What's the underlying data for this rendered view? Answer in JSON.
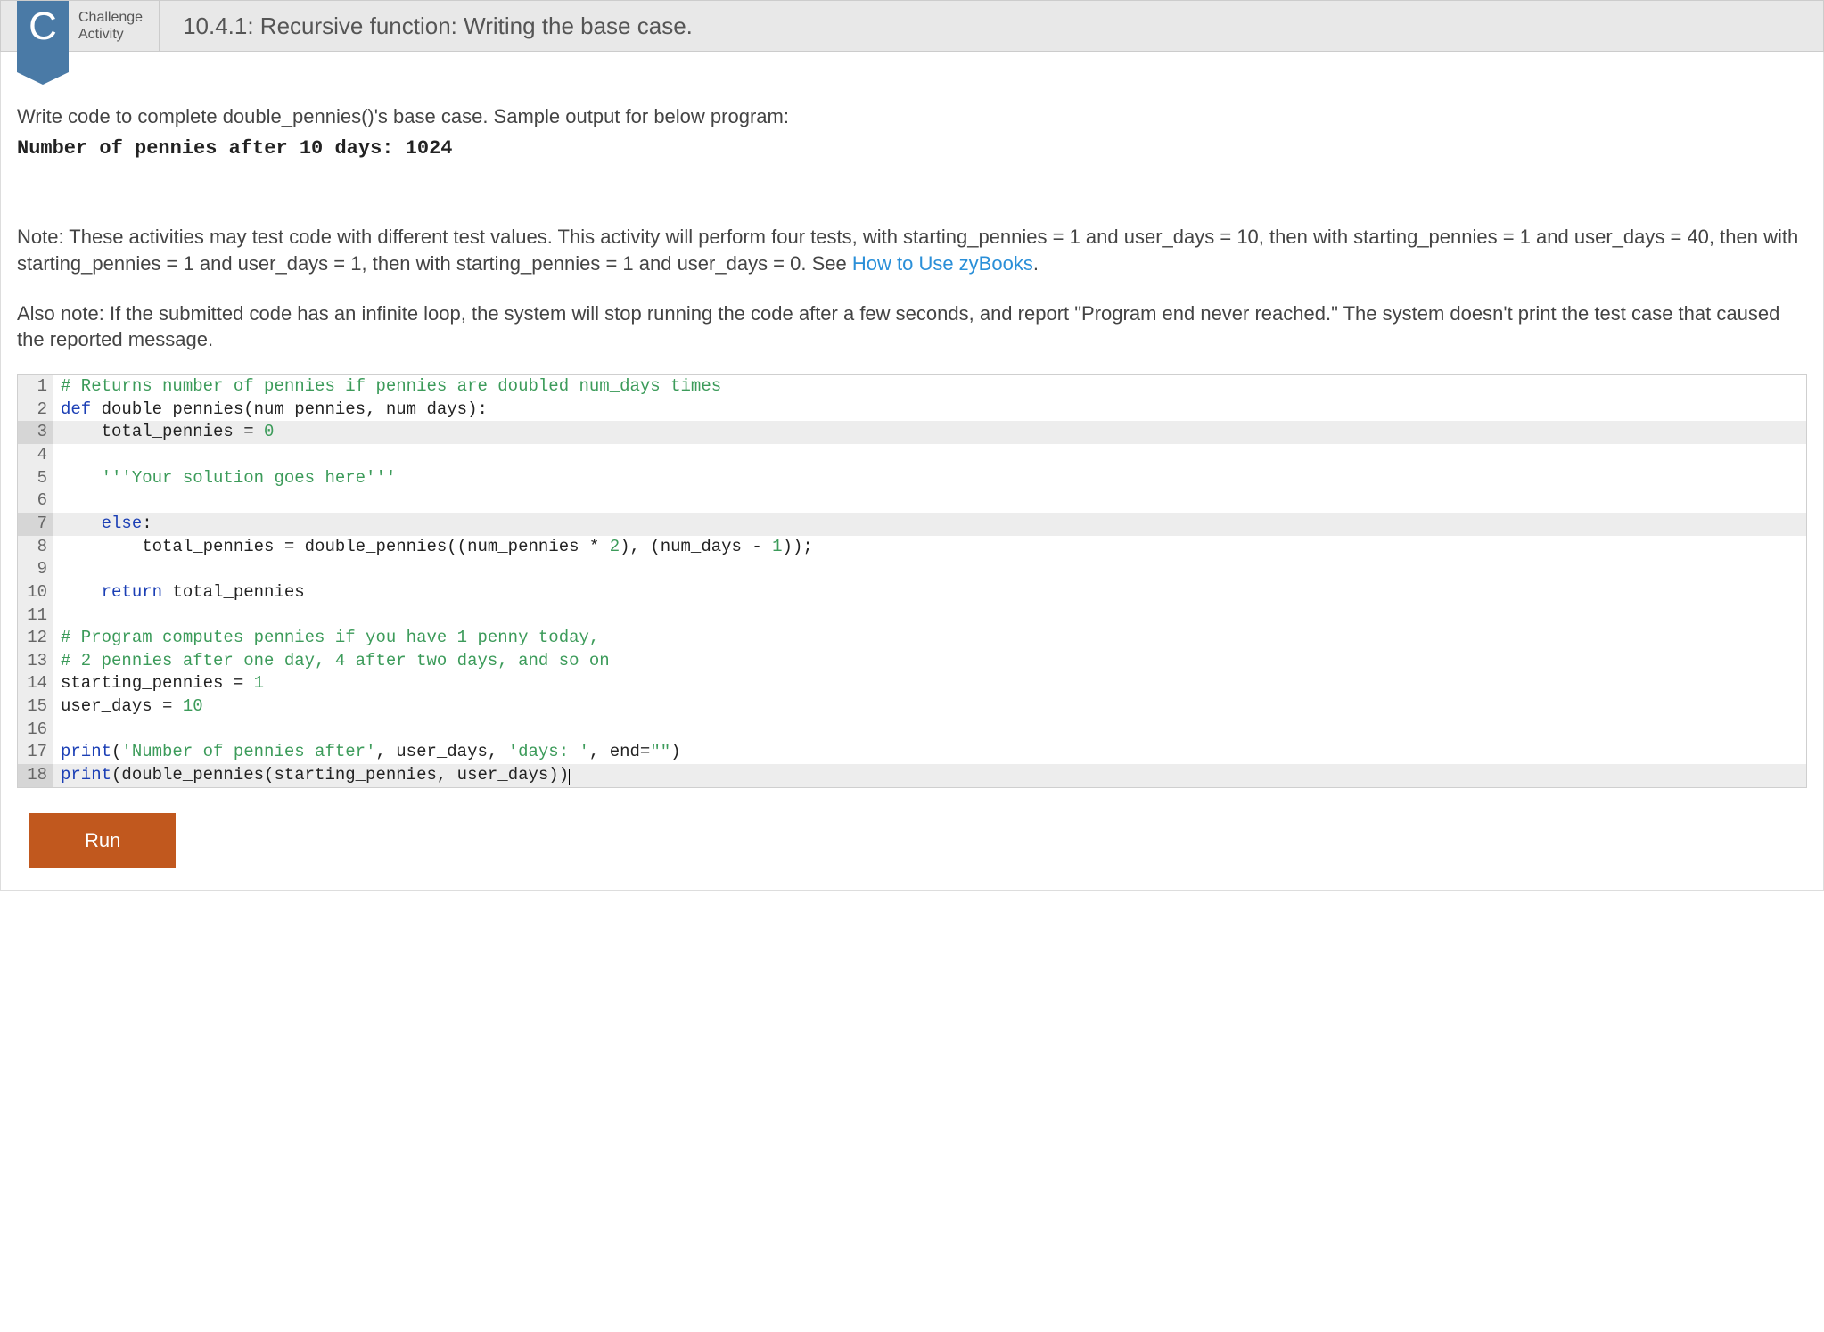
{
  "header": {
    "badge_letter": "C",
    "badge_line1": "Challenge",
    "badge_line2": "Activity",
    "title": "10.4.1: Recursive function: Writing the base case."
  },
  "instructions": {
    "prompt": "Write code to complete double_pennies()'s base case. Sample output for below program:",
    "sample_output": "Number of pennies after 10 days: 1024",
    "note_prefix": "Note: These activities may test code with different test values. This activity will perform four tests, with starting_pennies = 1 and user_days = 10, then with starting_pennies = 1 and user_days = 40, then with starting_pennies = 1 and user_days = 1, then with starting_pennies = 1 and user_days = 0. See ",
    "note_link_text": "How to Use zyBooks",
    "note_suffix": ".",
    "sub_note": "Also note: If the submitted code has an infinite loop, the system will stop running the code after a few seconds, and report \"Program end never reached.\" The system doesn't print the test case that caused the reported message."
  },
  "code": {
    "highlighted_lines": [
      3,
      7,
      18
    ],
    "lines": [
      {
        "n": 1,
        "tokens": [
          {
            "t": "# Returns number of pennies if pennies are doubled num_days times",
            "c": "comment"
          }
        ]
      },
      {
        "n": 2,
        "tokens": [
          {
            "t": "def",
            "c": "keyword"
          },
          {
            "t": " double_pennies(num_pennies, num_days):",
            "c": "plain"
          }
        ]
      },
      {
        "n": 3,
        "tokens": [
          {
            "t": "    total_pennies = ",
            "c": "plain"
          },
          {
            "t": "0",
            "c": "number"
          }
        ]
      },
      {
        "n": 4,
        "tokens": []
      },
      {
        "n": 5,
        "tokens": [
          {
            "t": "    ",
            "c": "plain"
          },
          {
            "t": "'''Your solution goes here'''",
            "c": "string"
          }
        ]
      },
      {
        "n": 6,
        "tokens": []
      },
      {
        "n": 7,
        "tokens": [
          {
            "t": "    ",
            "c": "plain"
          },
          {
            "t": "else",
            "c": "keyword"
          },
          {
            "t": ":",
            "c": "plain"
          }
        ]
      },
      {
        "n": 8,
        "tokens": [
          {
            "t": "        total_pennies = double_pennies((num_pennies * ",
            "c": "plain"
          },
          {
            "t": "2",
            "c": "number"
          },
          {
            "t": "), (num_days - ",
            "c": "plain"
          },
          {
            "t": "1",
            "c": "number"
          },
          {
            "t": "));",
            "c": "plain"
          }
        ]
      },
      {
        "n": 9,
        "tokens": []
      },
      {
        "n": 10,
        "tokens": [
          {
            "t": "    ",
            "c": "plain"
          },
          {
            "t": "return",
            "c": "keyword"
          },
          {
            "t": " total_pennies",
            "c": "plain"
          }
        ]
      },
      {
        "n": 11,
        "tokens": []
      },
      {
        "n": 12,
        "tokens": [
          {
            "t": "# Program computes pennies if you have 1 penny today,",
            "c": "comment"
          }
        ]
      },
      {
        "n": 13,
        "tokens": [
          {
            "t": "# 2 pennies after one day, 4 after two days, and so on",
            "c": "comment"
          }
        ]
      },
      {
        "n": 14,
        "tokens": [
          {
            "t": "starting_pennies = ",
            "c": "plain"
          },
          {
            "t": "1",
            "c": "number"
          }
        ]
      },
      {
        "n": 15,
        "tokens": [
          {
            "t": "user_days = ",
            "c": "plain"
          },
          {
            "t": "10",
            "c": "number"
          }
        ]
      },
      {
        "n": 16,
        "tokens": []
      },
      {
        "n": 17,
        "tokens": [
          {
            "t": "print",
            "c": "keyword"
          },
          {
            "t": "(",
            "c": "plain"
          },
          {
            "t": "'Number of pennies after'",
            "c": "string"
          },
          {
            "t": ", user_days, ",
            "c": "plain"
          },
          {
            "t": "'days: '",
            "c": "string"
          },
          {
            "t": ", end=",
            "c": "plain"
          },
          {
            "t": "\"\"",
            "c": "string"
          },
          {
            "t": ")",
            "c": "plain"
          }
        ]
      },
      {
        "n": 18,
        "tokens": [
          {
            "t": "print",
            "c": "keyword"
          },
          {
            "t": "(double_pennies(starting_pennies, user_days))",
            "c": "plain"
          }
        ],
        "cursor_after": true
      }
    ]
  },
  "buttons": {
    "run": "Run"
  }
}
